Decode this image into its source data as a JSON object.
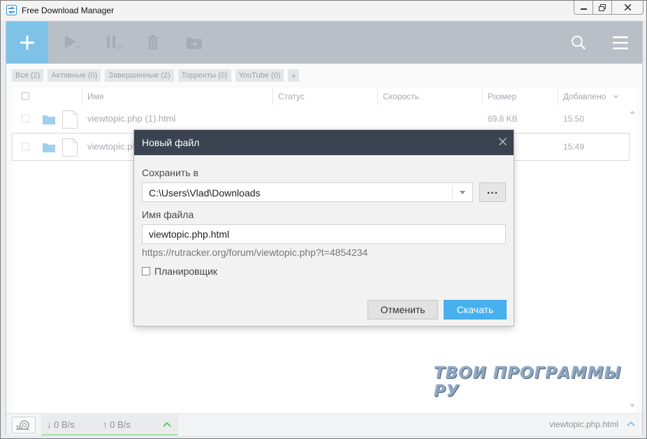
{
  "window": {
    "title": "Free Download Manager"
  },
  "filters": {
    "tabs": [
      {
        "label": "Все (2)"
      },
      {
        "label": "Активные (0)"
      },
      {
        "label": "Завершенные (2)"
      },
      {
        "label": "Торренты (0)"
      },
      {
        "label": "YouTube (0)"
      }
    ],
    "add_label": "+"
  },
  "table": {
    "columns": {
      "name": "Имя",
      "status": "Статус",
      "speed": "Скорость",
      "size": "Размер",
      "added": "Добавлено"
    },
    "rows": [
      {
        "name": "viewtopic.php (1).html",
        "size": "69.8 KB",
        "added": "15:50"
      },
      {
        "name": "viewtopic.php",
        "size": "",
        "added": "15:49"
      }
    ]
  },
  "dialog": {
    "title": "Новый файл",
    "save_to_label": "Сохранить в",
    "save_to_value": "C:\\Users\\Vlad\\Downloads",
    "browse_label": "...",
    "filename_label": "Имя файла",
    "filename_value": "viewtopic.php.html",
    "url": "https://rutracker.org/forum/viewtopic.php?t=4854234",
    "scheduler_label": "Планировщик",
    "scheduler_checked": false,
    "cancel_label": "Отменить",
    "download_label": "Скачать"
  },
  "statusbar": {
    "down_speed": "↓  0 B/s",
    "up_speed": "↑ 0 B/s",
    "current_file": "viewtopic.php.html"
  },
  "watermark": "ТВОИ ПРОГРАММЫ РУ",
  "colors": {
    "toolbar": "#b9bfc6",
    "add_button": "#7fc2e8",
    "dialog_header": "#3a434f",
    "primary_button": "#47b1f0"
  }
}
